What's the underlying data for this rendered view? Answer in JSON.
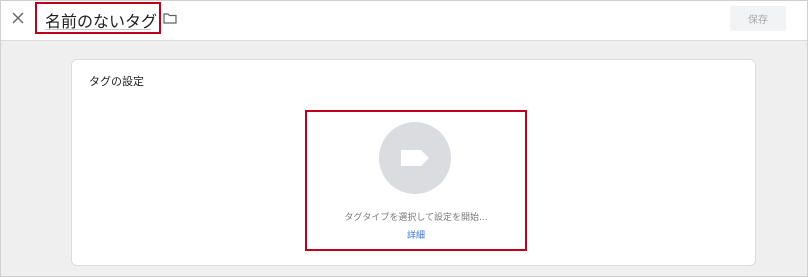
{
  "header": {
    "close_icon": "close-icon",
    "title": "名前のないタグ",
    "folder_icon": "folder-icon",
    "save_label": "保存"
  },
  "tag_config": {
    "section_title": "タグの設定",
    "tag_icon": "tag-icon",
    "choose_text": "タグタイプを選択して設定を開始...",
    "detail_link": "詳細"
  },
  "colors": {
    "highlight_border": "#c0001a",
    "link": "#3b6fd4",
    "icon_circle": "#dadce0"
  }
}
